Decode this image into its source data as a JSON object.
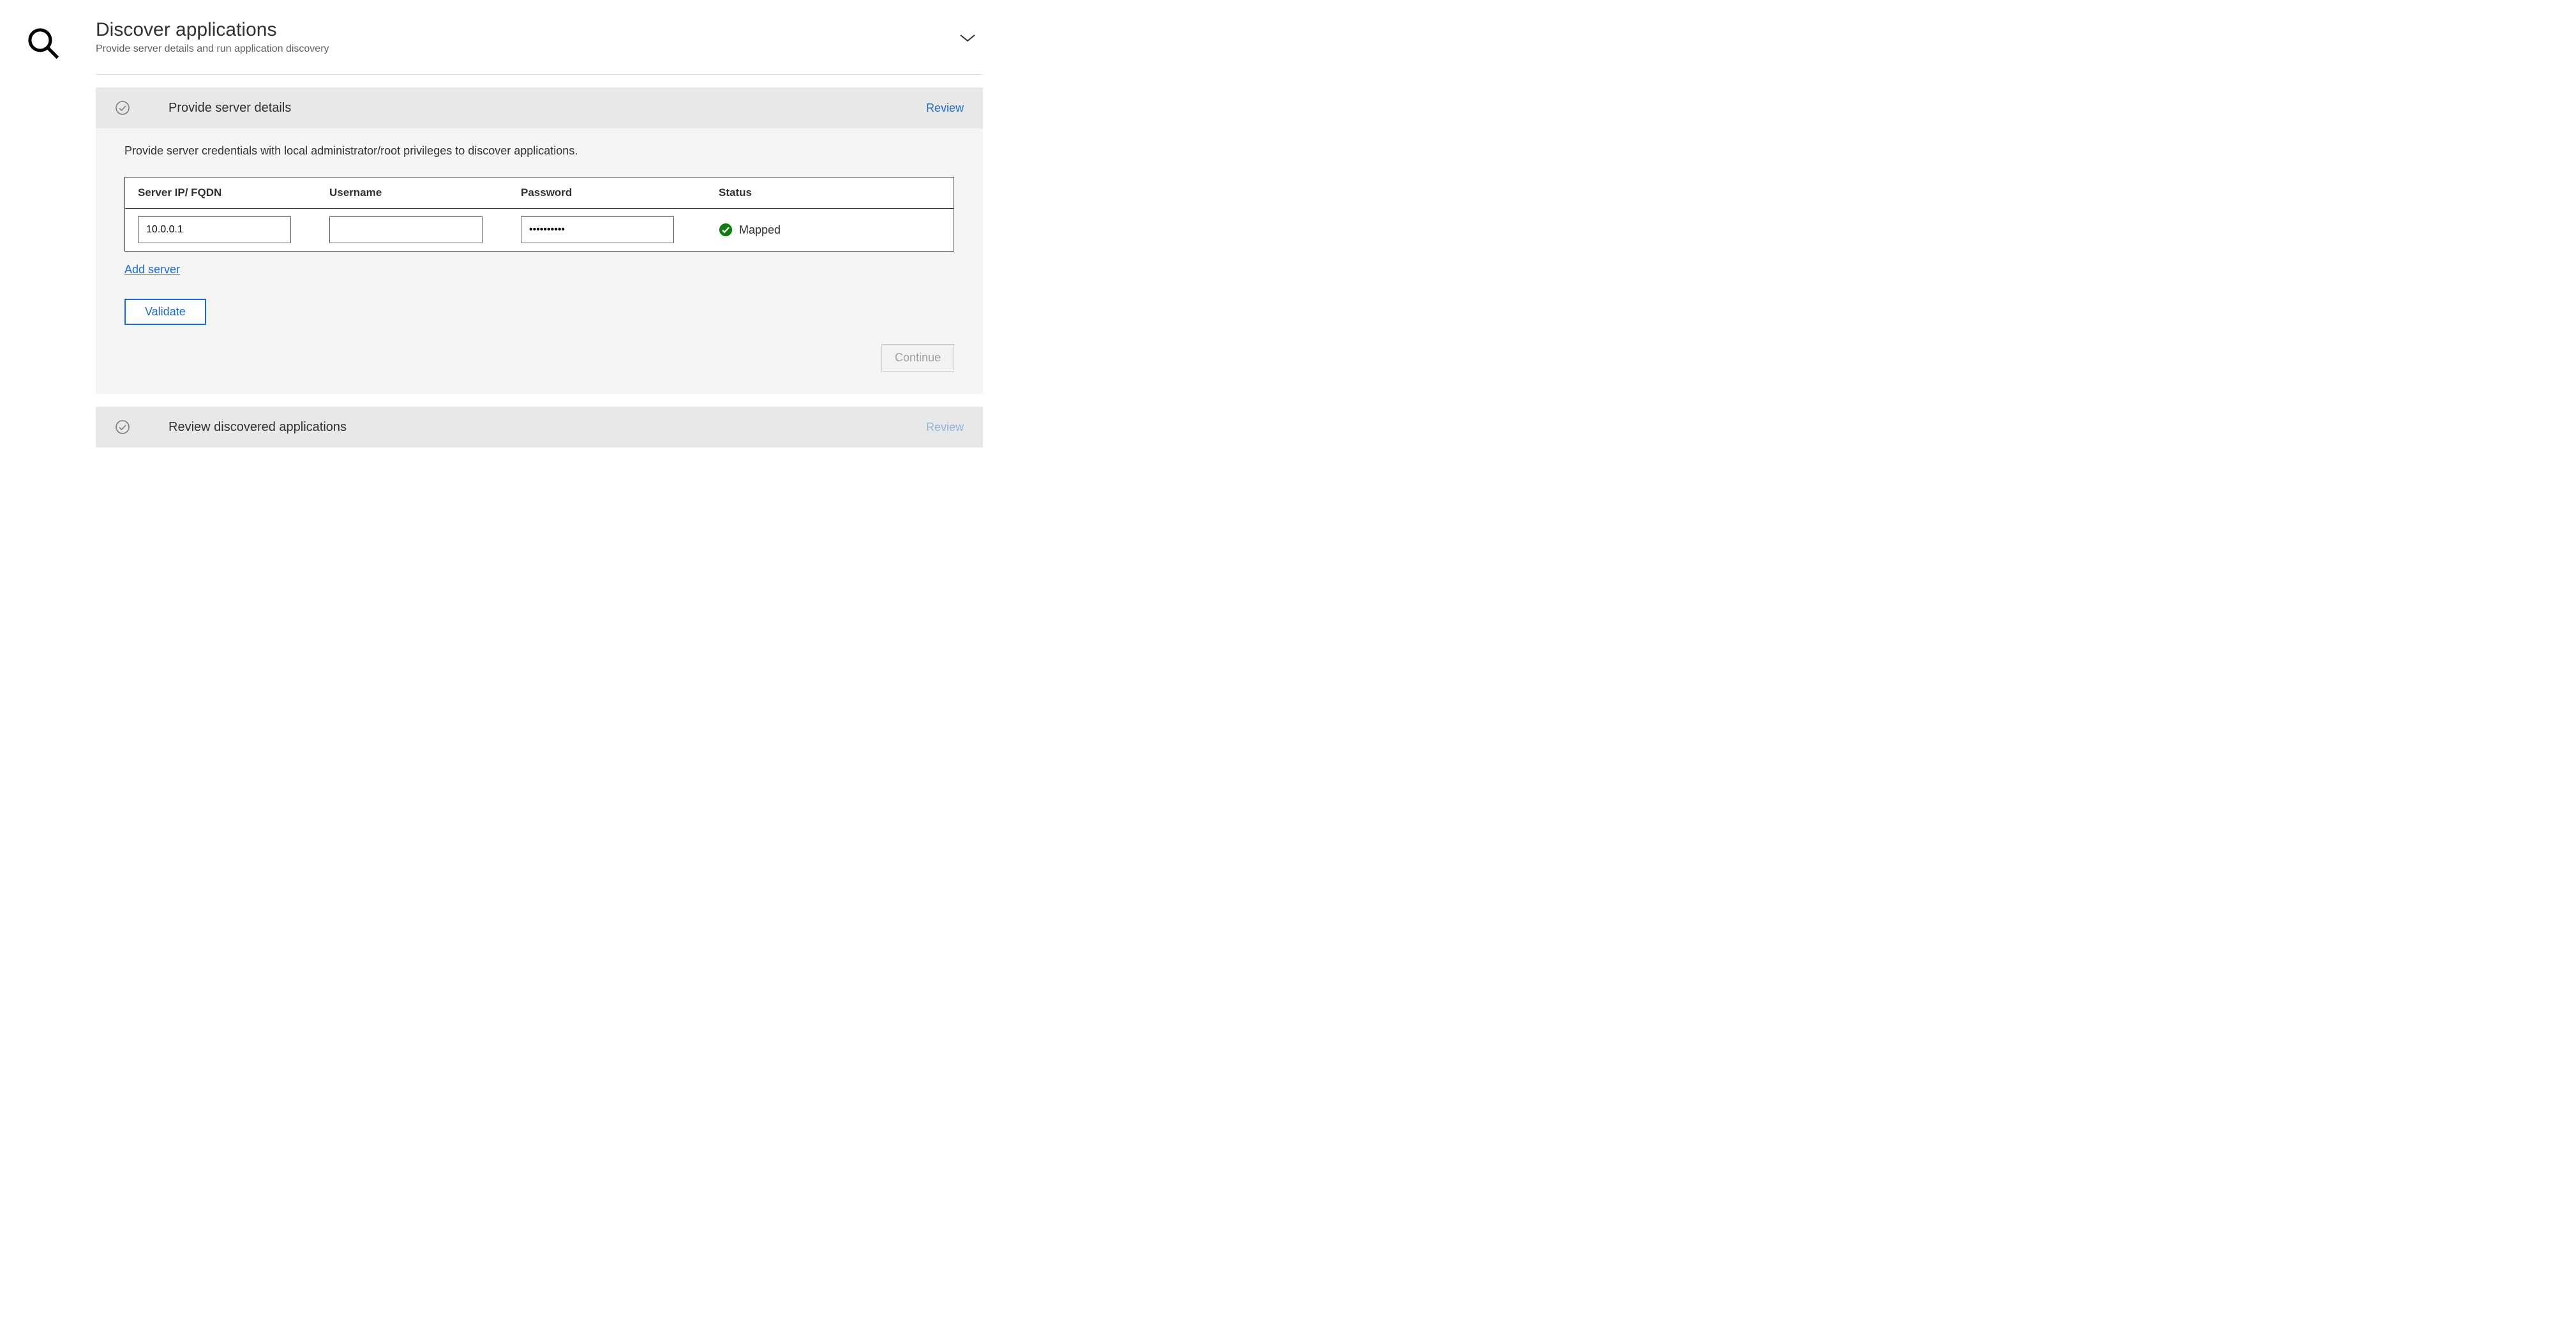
{
  "header": {
    "title": "Discover applications",
    "subtitle": "Provide server details and run application discovery"
  },
  "section1": {
    "title": "Provide server details",
    "review_label": "Review",
    "instruction": "Provide server credentials with local administrator/root privileges to discover applications.",
    "columns": {
      "ip": "Server IP/ FQDN",
      "username": "Username",
      "password": "Password",
      "status": "Status"
    },
    "row": {
      "ip_value": "10.0.0.1",
      "username_value": "",
      "password_value": "••••••••••",
      "status_label": "Mapped"
    },
    "add_server_label": "Add server",
    "validate_label": "Validate",
    "continue_label": "Continue"
  },
  "section2": {
    "title": "Review discovered applications",
    "review_label": "Review"
  }
}
